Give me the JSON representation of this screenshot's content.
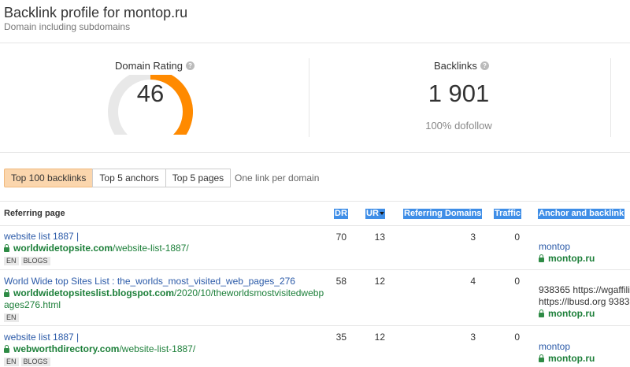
{
  "header": {
    "title": "Backlink profile for montop.ru",
    "subtitle": "Domain including subdomains"
  },
  "metrics": {
    "domain_rating": {
      "label": "Domain Rating",
      "value": "46",
      "gauge_fraction": 0.46,
      "gauge_color": "#ff8a00",
      "track_color": "#e8e8e8"
    },
    "backlinks": {
      "label": "Backlinks",
      "value": "1 901",
      "sub": "100% dofollow"
    }
  },
  "tabs": [
    {
      "label": "Top 100 backlinks",
      "active": true
    },
    {
      "label": "Top 5 anchors",
      "active": false
    },
    {
      "label": "Top 5 pages",
      "active": false
    }
  ],
  "option_label": "One link per domain",
  "table": {
    "columns": {
      "referring_page": "Referring page",
      "dr": "DR",
      "ur": "UR",
      "referring_domains": "Referring Domains",
      "traffic": "Traffic",
      "anchor": "Anchor and backlink"
    },
    "rows": [
      {
        "title": "website list 1887 |",
        "url_domain": "worldwidetopsite.com",
        "url_path": "/website-list-1887/",
        "tags": [
          "EN",
          "BLOGS"
        ],
        "dr": "70",
        "ur": "13",
        "rd": "3",
        "traffic": "0",
        "anchor_text": "montop",
        "anchor_domain": "montop.ru"
      },
      {
        "title": "World Wide top Sites List : the_worlds_most_visited_web_pages_276",
        "url_domain": "worldwidetopsiteslist.blogspot.com",
        "url_path": "/2020/10/theworldsmostvisitedwebp",
        "url_path_2": "ages276.html",
        "tags": [
          "EN"
        ],
        "dr": "58",
        "ur": "12",
        "rd": "4",
        "traffic": "0",
        "anchor_line1": "938365 https://wgaffili",
        "anchor_line2": "https://lbusd.org 9383(",
        "anchor_domain": "montop.ru"
      },
      {
        "title": "website list 1887 |",
        "url_domain": "webworthdirectory.com",
        "url_path": "/website-list-1887/",
        "tags": [
          "EN",
          "BLOGS"
        ],
        "dr": "35",
        "ur": "12",
        "rd": "3",
        "traffic": "0",
        "anchor_text": "montop",
        "anchor_domain": "montop.ru"
      }
    ]
  }
}
